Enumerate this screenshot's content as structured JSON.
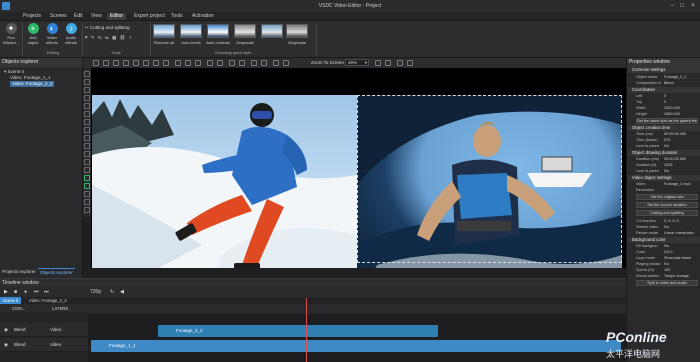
{
  "app": {
    "title": "VSDC Video Editor - Project",
    "window_controls": [
      "−",
      "□",
      "×"
    ]
  },
  "menu": {
    "items": [
      {
        "label": "Projects"
      },
      {
        "label": "Scenes"
      },
      {
        "label": "Edit"
      },
      {
        "label": "View"
      },
      {
        "label": "Editor",
        "active": true
      },
      {
        "label": "Export project"
      },
      {
        "label": "Tools"
      },
      {
        "label": "Activation"
      }
    ]
  },
  "ribbon": {
    "buttons": [
      {
        "label": "Run Wizard...",
        "icon": "wizard-icon"
      },
      {
        "label": "Add object",
        "icon": "add-object-icon"
      },
      {
        "label": "Video effects",
        "icon": "video-effects-icon"
      },
      {
        "label": "Audio effects",
        "icon": "audio-effects-icon"
      }
    ],
    "editing_label": "Editing",
    "cutting_label": "Cutting and splitting",
    "tools_label": "Tools",
    "styles": [
      {
        "label": "Remove all"
      },
      {
        "label": "Auto levels"
      },
      {
        "label": "Auto contrast"
      },
      {
        "label": "Grayscale"
      },
      {
        "label": "Grayscale"
      }
    ],
    "quick_style_label": "Choosing quick style"
  },
  "objects_explorer": {
    "title": "Objects explorer",
    "tree": [
      {
        "label": "Scene 0",
        "level": 0
      },
      {
        "label": "Video: Footage_1_1",
        "level": 1
      },
      {
        "label": "Video: Footage_2_2",
        "level": 1,
        "selected": true
      }
    ],
    "tabs": [
      "Projects explorer",
      "Objects explorer"
    ]
  },
  "editor_toolbar": {
    "zoom_label": "Zoom To Screen",
    "zoom_value": "46%"
  },
  "properties": {
    "title": "Properties window",
    "common_settings": "Common settings",
    "object_name_key": "Object name",
    "object_name_value": "Footage_2_2",
    "composition_key": "Composition m",
    "composition_value": "Blend",
    "coordinates": "Coordinates",
    "coords": [
      {
        "k": "Left",
        "v": "0"
      },
      {
        "k": "Top",
        "v": "0"
      },
      {
        "k": "Width",
        "v": "1920.000"
      },
      {
        "k": "Height",
        "v": "1080.000"
      }
    ],
    "same_size_btn": "Set the same size as the parent fee",
    "creation_time": "Object creation time",
    "creation": [
      {
        "k": "Time (ms)",
        "v": "00:00:06.250"
      },
      {
        "k": "Time (frame)",
        "v": "375"
      },
      {
        "k": "Lock to paren",
        "v": "No"
      }
    ],
    "drawing_duration": "Object drawing duration",
    "drawing": [
      {
        "k": "Duration (ms)",
        "v": "00:00:25.583"
      },
      {
        "k": "Duration (fr)",
        "v": "1535"
      },
      {
        "k": "Lock to paren",
        "v": "No"
      }
    ],
    "video_settings": "Video object settings",
    "video": [
      {
        "k": "Video",
        "v": "Footage_2.mp4"
      },
      {
        "k": "Resolution",
        "v": ""
      }
    ],
    "original_size_btn": "Set the original size",
    "source_duration_btn": "Set the source duration",
    "cutting_btn": "Cutting and splitting",
    "cut_borders": [
      {
        "k": "Cut borders",
        "v": "0; 0; 0; 0"
      },
      {
        "k": "Stretch video",
        "v": "No"
      },
      {
        "k": "Resize mode",
        "v": "Linear interpolatio"
      }
    ],
    "bg_color": "Background color",
    "bg": [
      {
        "k": "Fill backgrou",
        "v": "No"
      },
      {
        "k": "Color",
        "v": "0;0;0"
      },
      {
        "k": "Loop mode",
        "v": "Show last frame"
      },
      {
        "k": "Playing backw",
        "v": "No"
      },
      {
        "k": "Speed (%)",
        "v": "100"
      },
      {
        "k": "Sound stretch",
        "v": "Tempo change"
      }
    ],
    "split_btn": "Split to video and audio"
  },
  "timeline": {
    "title": "Timeline window",
    "resolution": "720p",
    "tabs": [
      {
        "label": "Scene 0",
        "active": true
      },
      {
        "label": "Video: Footage_2_2"
      }
    ],
    "header": {
      "com": "COM...",
      "layers": "LAYERS"
    },
    "tracks": [
      {
        "blend": "Blend",
        "type": "Video",
        "clip": "Footage_2_2"
      },
      {
        "blend": "Blend",
        "type": "Video",
        "clip": "Footage_1_1"
      }
    ]
  },
  "watermark": {
    "brand": "PConline",
    "sub": "太平洋电脑网"
  }
}
